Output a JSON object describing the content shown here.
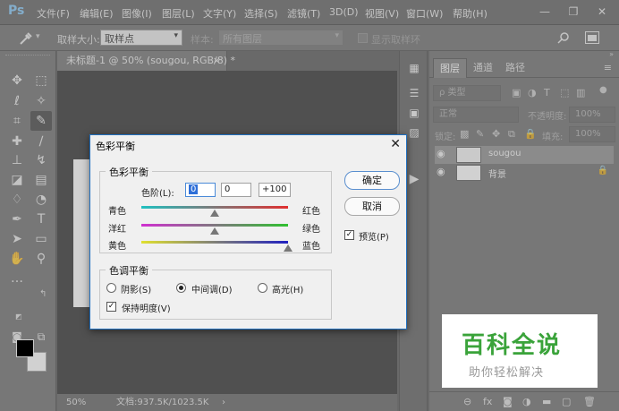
{
  "app": {
    "logo": "Ps"
  },
  "menu": [
    "文件(F)",
    "编辑(E)",
    "图像(I)",
    "图层(L)",
    "文字(Y)",
    "选择(S)",
    "滤镜(T)",
    "3D(D)",
    "视图(V)",
    "窗口(W)",
    "帮助(H)"
  ],
  "window_controls": {
    "minimize": "—",
    "restore": "❐",
    "close": "✕"
  },
  "options_bar": {
    "sample_size_label": "取样大小:",
    "sample_size_value": "取样点",
    "sample_label": "样本:",
    "sample_value": "所有图层",
    "show_ring_label": "显示取样环"
  },
  "document": {
    "tab_title": "未标题-1 @ 50% (sougou, RGB/8) *",
    "tab_close": "×",
    "zoom": "50%",
    "doc_size": "文档:937.5K/1023.5K",
    "status_arrow": "›"
  },
  "layers_panel": {
    "tabs": [
      "图层",
      "通道",
      "路径"
    ],
    "kind_filter": "ρ 类型",
    "blend_mode": "正常",
    "opacity_label": "不透明度:",
    "opacity_value": "100%",
    "lock_label": "锁定:",
    "fill_label": "填充:",
    "fill_value": "100%",
    "layers": [
      {
        "name": "sougou",
        "selected": true
      },
      {
        "name": "背景",
        "selected": false,
        "locked": true
      }
    ]
  },
  "dialog": {
    "title": "色彩平衡",
    "close": "✕",
    "color_balance_group": "色彩平衡",
    "levels_label": "色阶(L):",
    "levels": [
      "0",
      "0",
      "+100"
    ],
    "sliders": [
      {
        "left": "青色",
        "right": "红色",
        "value": 0,
        "colors": [
          "#20c0c0",
          "#e03030"
        ]
      },
      {
        "left": "洋红",
        "right": "绿色",
        "value": 0,
        "colors": [
          "#d030d0",
          "#30c030"
        ]
      },
      {
        "left": "黄色",
        "right": "蓝色",
        "value": 100,
        "colors": [
          "#e0e030",
          "#2020c0"
        ]
      }
    ],
    "tone_balance_group": "色调平衡",
    "tones": [
      {
        "label": "阴影(S)",
        "checked": false
      },
      {
        "label": "中间调(D)",
        "checked": true
      },
      {
        "label": "高光(H)",
        "checked": false
      }
    ],
    "preserve_luminosity": "保持明度(V)",
    "preserve_checked": true,
    "ok_button": "确定",
    "cancel_button": "取消",
    "preview_label": "预览(P)",
    "preview_checked": true,
    "check_mark": "✓"
  },
  "watermark": {
    "main": "百科全说",
    "sub": "助你轻松解决"
  },
  "icons": {
    "eyedropper": "eyedropper-icon",
    "search": "search-icon",
    "eye": "eye-icon",
    "lock": "lock-icon"
  },
  "colors": {
    "foreground": "#000000",
    "background": "#ffffff",
    "accent": "#1f6fbf",
    "watermark_green": "#3aa33a"
  }
}
